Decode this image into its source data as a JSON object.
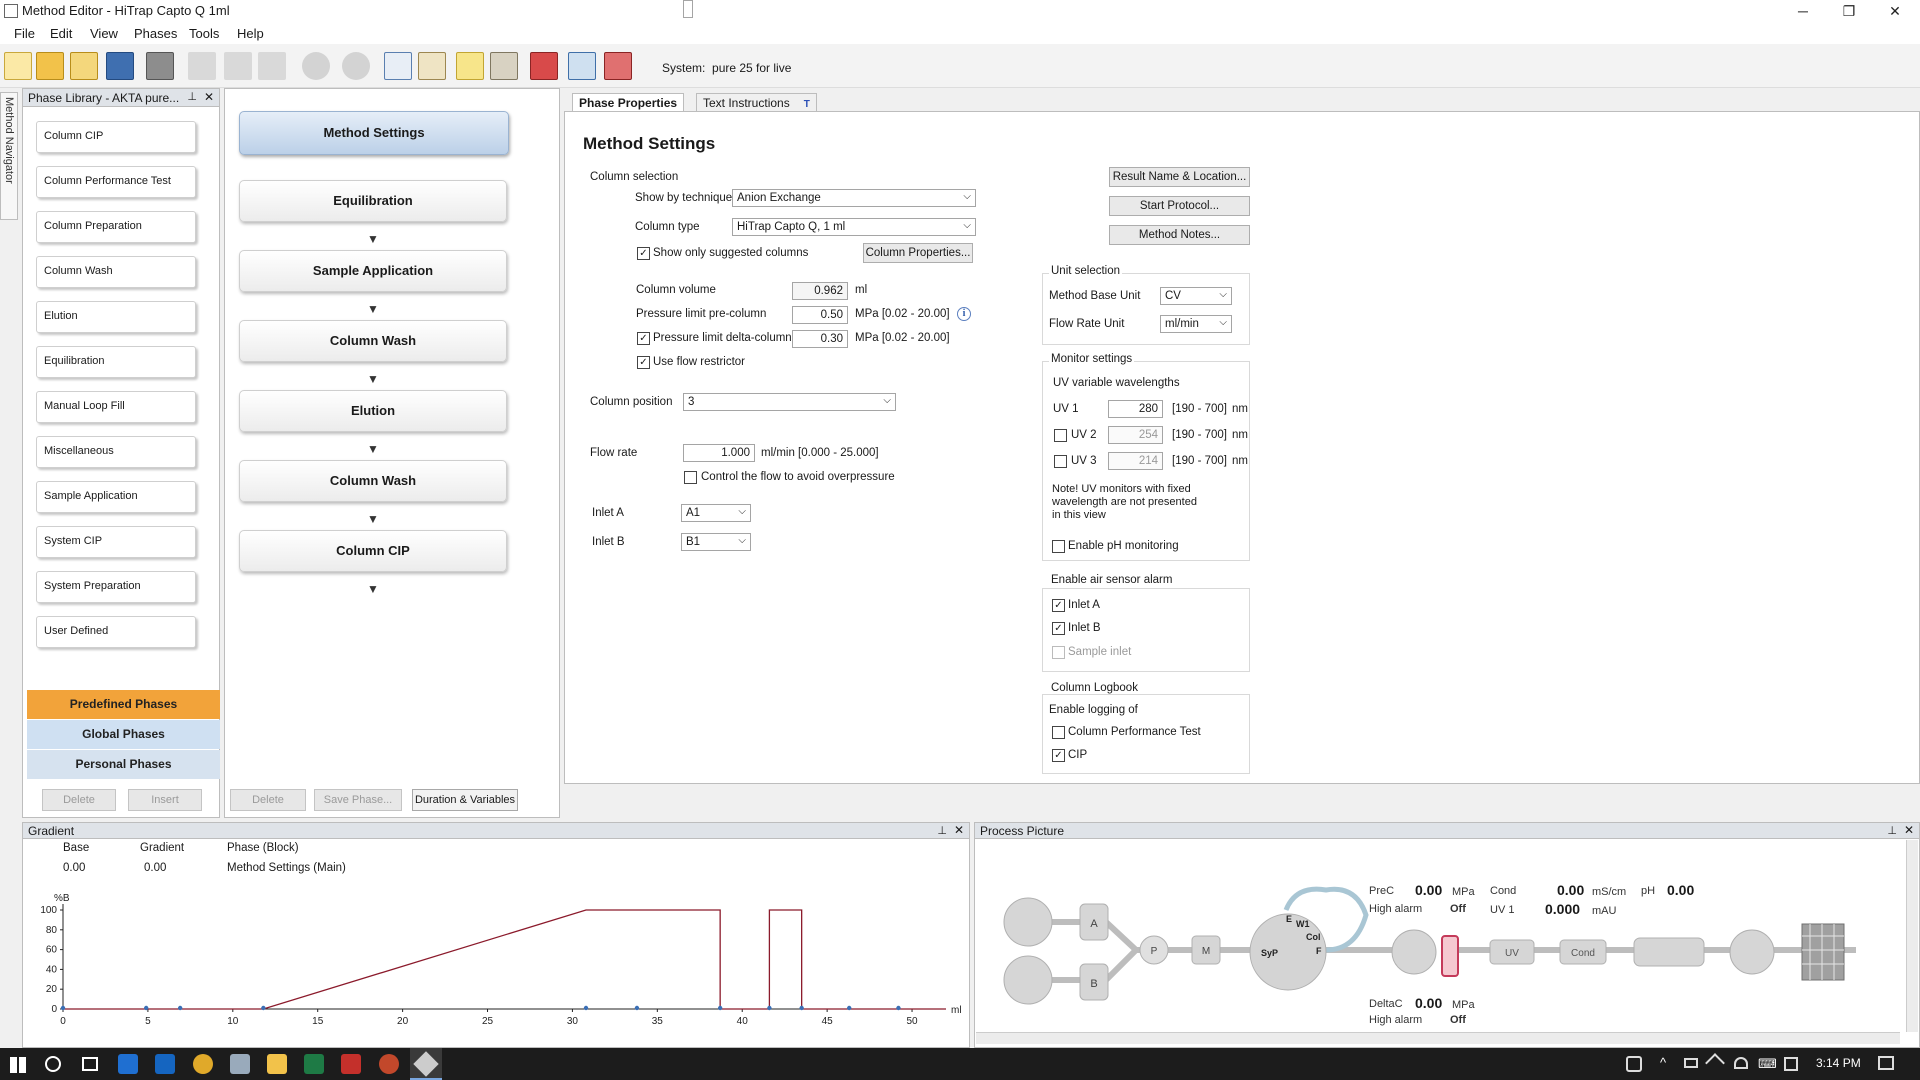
{
  "window": {
    "title": "Method Editor - HiTrap Capto Q 1ml",
    "controls": [
      "─",
      "❐",
      "✕"
    ]
  },
  "menu": [
    "File",
    "Edit",
    "View",
    "Phases",
    "Tools",
    "Help"
  ],
  "toolbar": {
    "system_label": "System:",
    "system_name": "pure 25 for live"
  },
  "navigator": {
    "label": "Method Navigator"
  },
  "phase_library": {
    "title": "Phase Library - AKTA pure...",
    "items": [
      "Column CIP",
      "Column Performance Test",
      "Column Preparation",
      "Column Wash",
      "Elution",
      "Equilibration",
      "Manual Loop Fill",
      "Miscellaneous",
      "Sample Application",
      "System CIP",
      "System Preparation",
      "User Defined"
    ],
    "categories": [
      {
        "label": "Predefined Phases",
        "color": "#f2a33a"
      },
      {
        "label": "Global Phases",
        "color": "#cfe0f2"
      },
      {
        "label": "Personal Phases",
        "color": "#d6e2ef"
      }
    ],
    "delete_label": "Delete",
    "insert_label": "Insert"
  },
  "method_outline": {
    "phases": [
      "Method Settings",
      "Equilibration",
      "Sample Application",
      "Column Wash",
      "Elution",
      "Column Wash",
      "Column CIP"
    ],
    "delete_label": "Delete",
    "save_label": "Save Phase...",
    "duration_label": "Duration & Variables"
  },
  "tabs": {
    "phase_properties": "Phase Properties",
    "text_instructions": "Text Instructions",
    "ti_badge": "T"
  },
  "method_settings": {
    "heading": "Method Settings",
    "column_selection": "Column selection",
    "show_by_technique_label": "Show by technique",
    "show_by_technique_value": "Anion Exchange",
    "column_type_label": "Column type",
    "column_type_value": "HiTrap Capto Q, 1 ml",
    "show_suggested_label": "Show only suggested columns",
    "column_properties_label": "Column Properties...",
    "column_volume_label": "Column volume",
    "column_volume_value": "0.962",
    "column_volume_unit": "ml",
    "pressure_pre_label": "Pressure limit pre-column",
    "pressure_pre_value": "0.50",
    "pressure_pre_range": "MPa [0.02 - 20.00]",
    "pressure_delta_label": "Pressure limit delta-column",
    "pressure_delta_value": "0.30",
    "pressure_delta_range": "MPa [0.02 - 20.00]",
    "flow_restrictor_label": "Use flow restrictor",
    "column_position_label": "Column position",
    "column_position_value": "3",
    "flow_rate_label": "Flow rate",
    "flow_rate_value": "1.000",
    "flow_rate_range": "ml/min  [0.000 - 25.000]",
    "control_flow_label": "Control the flow to avoid overpressure",
    "inlet_a_label": "Inlet A",
    "inlet_a_value": "A1",
    "inlet_b_label": "Inlet B",
    "inlet_b_value": "B1",
    "info_icon": "i"
  },
  "right_buttons": {
    "result": "Result Name & Location...",
    "start": "Start Protocol...",
    "notes": "Method Notes..."
  },
  "unit_selection": {
    "title": "Unit selection",
    "base_label": "Method Base Unit",
    "base_value": "CV",
    "flow_label": "Flow Rate Unit",
    "flow_value": "ml/min"
  },
  "monitor_settings": {
    "title": "Monitor settings",
    "uv_title": "UV variable wavelengths",
    "uv1_label": "UV 1",
    "uv1_value": "280",
    "uv1_range": "[190 - 700]",
    "uv1_unit": "nm",
    "uv2_label": "UV 2",
    "uv2_value": "254",
    "uv2_range": "[190 - 700]",
    "uv2_unit": "nm",
    "uv3_label": "UV 3",
    "uv3_value": "214",
    "uv3_range": "[190 - 700]",
    "uv3_unit": "nm",
    "note1": "Note! UV monitors with fixed",
    "note2": "wavelength are not presented",
    "note3": "in this view",
    "ph_label": "Enable pH monitoring"
  },
  "air_sensor": {
    "title": "Enable air sensor alarm",
    "inlet_a": "Inlet A",
    "inlet_b": "Inlet B",
    "sample": "Sample inlet"
  },
  "logbook": {
    "title": "Column Logbook",
    "enable": "Enable logging of",
    "cpt": "Column Performance Test",
    "cip": "CIP"
  },
  "gradient": {
    "title": "Gradient",
    "col_base": "Base",
    "col_gradient": "Gradient",
    "col_phase": "Phase (Block)",
    "base_value": "0.00",
    "gradient_value": "0.00",
    "phase_value": "Method Settings (Main)",
    "y_label": "%B",
    "x_unit": "ml",
    "y_ticks": [
      "100",
      "80",
      "60",
      "40",
      "20",
      "0"
    ],
    "x_ticks": [
      "0",
      "5",
      "10",
      "15",
      "20",
      "25",
      "30",
      "35",
      "40",
      "45",
      "50"
    ]
  },
  "chart_data": {
    "type": "line",
    "xlabel": "ml",
    "ylabel": "%B",
    "xlim": [
      0,
      52
    ],
    "ylim": [
      0,
      100
    ],
    "x": [
      0,
      11.8,
      30.8,
      38.7,
      38.7,
      41.6,
      41.6,
      43.5,
      43.5,
      52
    ],
    "y": [
      0,
      0,
      100,
      100,
      0,
      0,
      100,
      100,
      0,
      0
    ],
    "markers": [
      0,
      4.9,
      6.9,
      11.8,
      30.8,
      33.8,
      38.7,
      41.6,
      43.5,
      46.3,
      49.2
    ]
  },
  "process_picture": {
    "title": "Process Picture",
    "prec_label": "PreC",
    "prec_value": "0.00",
    "prec_unit": "MPa",
    "high_alarm_label": "High alarm",
    "high_alarm_value": "Off",
    "cond_label": "Cond",
    "cond_value": "0.00",
    "cond_unit": "mS/cm",
    "ph_label": "pH",
    "ph_value": "0.00",
    "uv1_label": "UV 1",
    "uv1_value": "0.000",
    "uv1_unit": "mAU",
    "deltac_label": "DeltaC",
    "deltac_value": "0.00",
    "deltac_unit": "MPa",
    "high_alarm2_label": "High alarm",
    "high_alarm2_value": "Off",
    "nodes": {
      "a": "A",
      "b": "B",
      "p": "P",
      "m": "M",
      "syp": "SyP",
      "uv": "UV",
      "cond": "Cond",
      "e": "E",
      "w1": "W1",
      "col": "Col",
      "f": "F"
    }
  },
  "taskbar": {
    "time": "3:14 PM"
  },
  "colors": {
    "gradient_line": "#8b1a2b",
    "marker": "#3a6fb5",
    "predefined": "#f2a33a"
  }
}
